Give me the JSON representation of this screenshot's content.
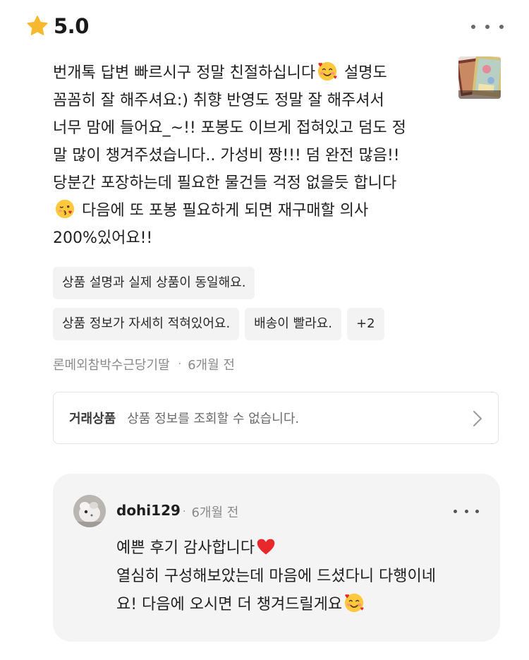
{
  "rating": {
    "value": "5.0",
    "star_color": "#F5B82E"
  },
  "review": {
    "lines": [
      "번개톡 답변 빠르시구 정말 친절하십니다",
      " 설명도",
      "꼼꼼히 잘 해주셔요:) 취향 반영도 정말 잘 해주셔서",
      "너무 맘에 들어요_~!! 포봉도 이브게 접혀있고 덤도 정",
      "말 많이 챙겨주셨습니다.. 가성비 짱!!! 덤 완전 많음!!",
      "당분간 포장하는데 필요한 물건들 걱정 없을듯 합니다",
      " 다음에 또 포봉 필요하게 되면 재구매할 의사",
      "200%있어요!!"
    ],
    "emoji_1": "smiling-face-with-hearts-icon",
    "emoji_2": "face-blowing-kiss-icon"
  },
  "tags": {
    "row1": [
      "상품 설명과 실제 상품이 동일해요."
    ],
    "row2": [
      "상품 정보가 자세히 적혀있어요.",
      "배송이 빨라요."
    ],
    "more": "+2"
  },
  "meta": {
    "author": "론메외참박수근당기딸",
    "separator": "·",
    "time": "6개월 전"
  },
  "product": {
    "label": "거래상품",
    "value": "상품 정보를 조회할 수 없습니다."
  },
  "reply": {
    "name": "dohi129",
    "separator": "·",
    "time": "6개월 전",
    "line1": "예쁜 후기 감사합니다",
    "line2": "열심히 구성해보았는데 마음에 드셨다니 다행이네",
    "line3": "요! 다음에 오시면 더 챙겨드릴게요",
    "heart_color": "#E8282B"
  }
}
